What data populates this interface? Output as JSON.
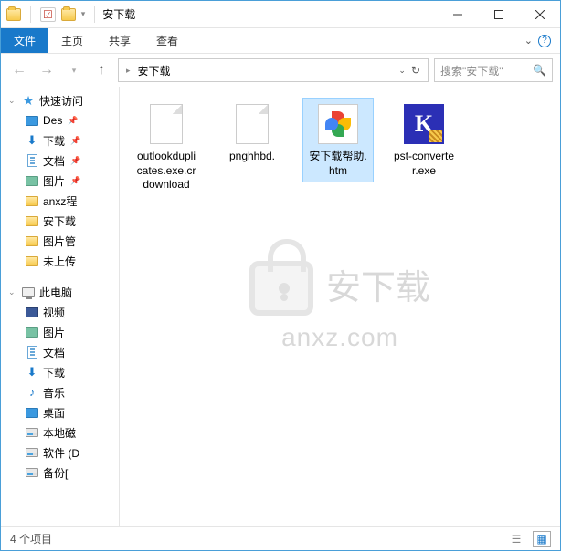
{
  "window": {
    "title": "安下载"
  },
  "ribbon": {
    "tabs": [
      {
        "label": "文件",
        "active": true
      },
      {
        "label": "主页"
      },
      {
        "label": "共享"
      },
      {
        "label": "查看"
      }
    ]
  },
  "address": {
    "crumb": "安下载"
  },
  "search": {
    "placeholder": "搜索\"安下载\""
  },
  "sidebar": {
    "quick": "快速访问",
    "items": [
      {
        "label": "Des",
        "icon": "desktop",
        "pinned": true
      },
      {
        "label": "下载",
        "icon": "down",
        "pinned": true
      },
      {
        "label": "文档",
        "icon": "doc",
        "pinned": true
      },
      {
        "label": "图片",
        "icon": "pic",
        "pinned": true
      },
      {
        "label": "anxz程",
        "icon": "folder"
      },
      {
        "label": "安下载",
        "icon": "folder"
      },
      {
        "label": "图片管",
        "icon": "folder"
      },
      {
        "label": "未上传",
        "icon": "folder"
      }
    ],
    "pc": "此电脑",
    "pcitems": [
      {
        "label": "视频",
        "icon": "video"
      },
      {
        "label": "图片",
        "icon": "pic"
      },
      {
        "label": "文档",
        "icon": "doc"
      },
      {
        "label": "下载",
        "icon": "down"
      },
      {
        "label": "音乐",
        "icon": "music"
      },
      {
        "label": "桌面",
        "icon": "desktop"
      },
      {
        "label": "本地磁",
        "icon": "drive"
      },
      {
        "label": "软件 (D",
        "icon": "drive"
      },
      {
        "label": "备份[一",
        "icon": "drive"
      }
    ]
  },
  "files": [
    {
      "label": "outlookduplicates.exe.crdownload",
      "type": "blank",
      "selected": false
    },
    {
      "label": "pnghhbd.",
      "type": "blank",
      "selected": false
    },
    {
      "label": "安下载帮助.htm",
      "type": "htm",
      "selected": true
    },
    {
      "label": "pst-converter.exe",
      "type": "k",
      "selected": false
    }
  ],
  "status": {
    "count": "4 个项目"
  },
  "watermark": {
    "text": "安下载",
    "sub": "anxz.com"
  }
}
